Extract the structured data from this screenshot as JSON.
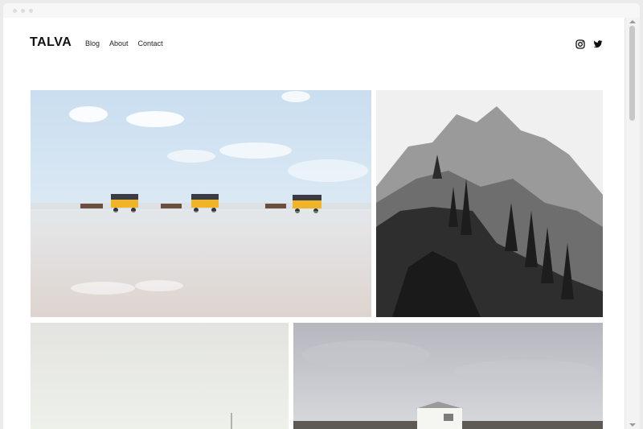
{
  "site": {
    "logo": "TALVA"
  },
  "nav": {
    "items": [
      "Blog",
      "About",
      "Contact"
    ]
  },
  "social": [
    "instagram-icon",
    "twitter-icon"
  ],
  "gallery": [
    {
      "name": "photo-beach-carriages",
      "description": "horse-drawn carriages on tidal flat"
    },
    {
      "name": "photo-mountain-bw",
      "description": "black and white mountain cliff with pines"
    },
    {
      "name": "photo-foggy-field",
      "description": "misty pale landscape"
    },
    {
      "name": "photo-white-hut",
      "description": "white hut under grey sky"
    }
  ],
  "colors": {
    "text": "#111111",
    "background": "#ffffff"
  }
}
